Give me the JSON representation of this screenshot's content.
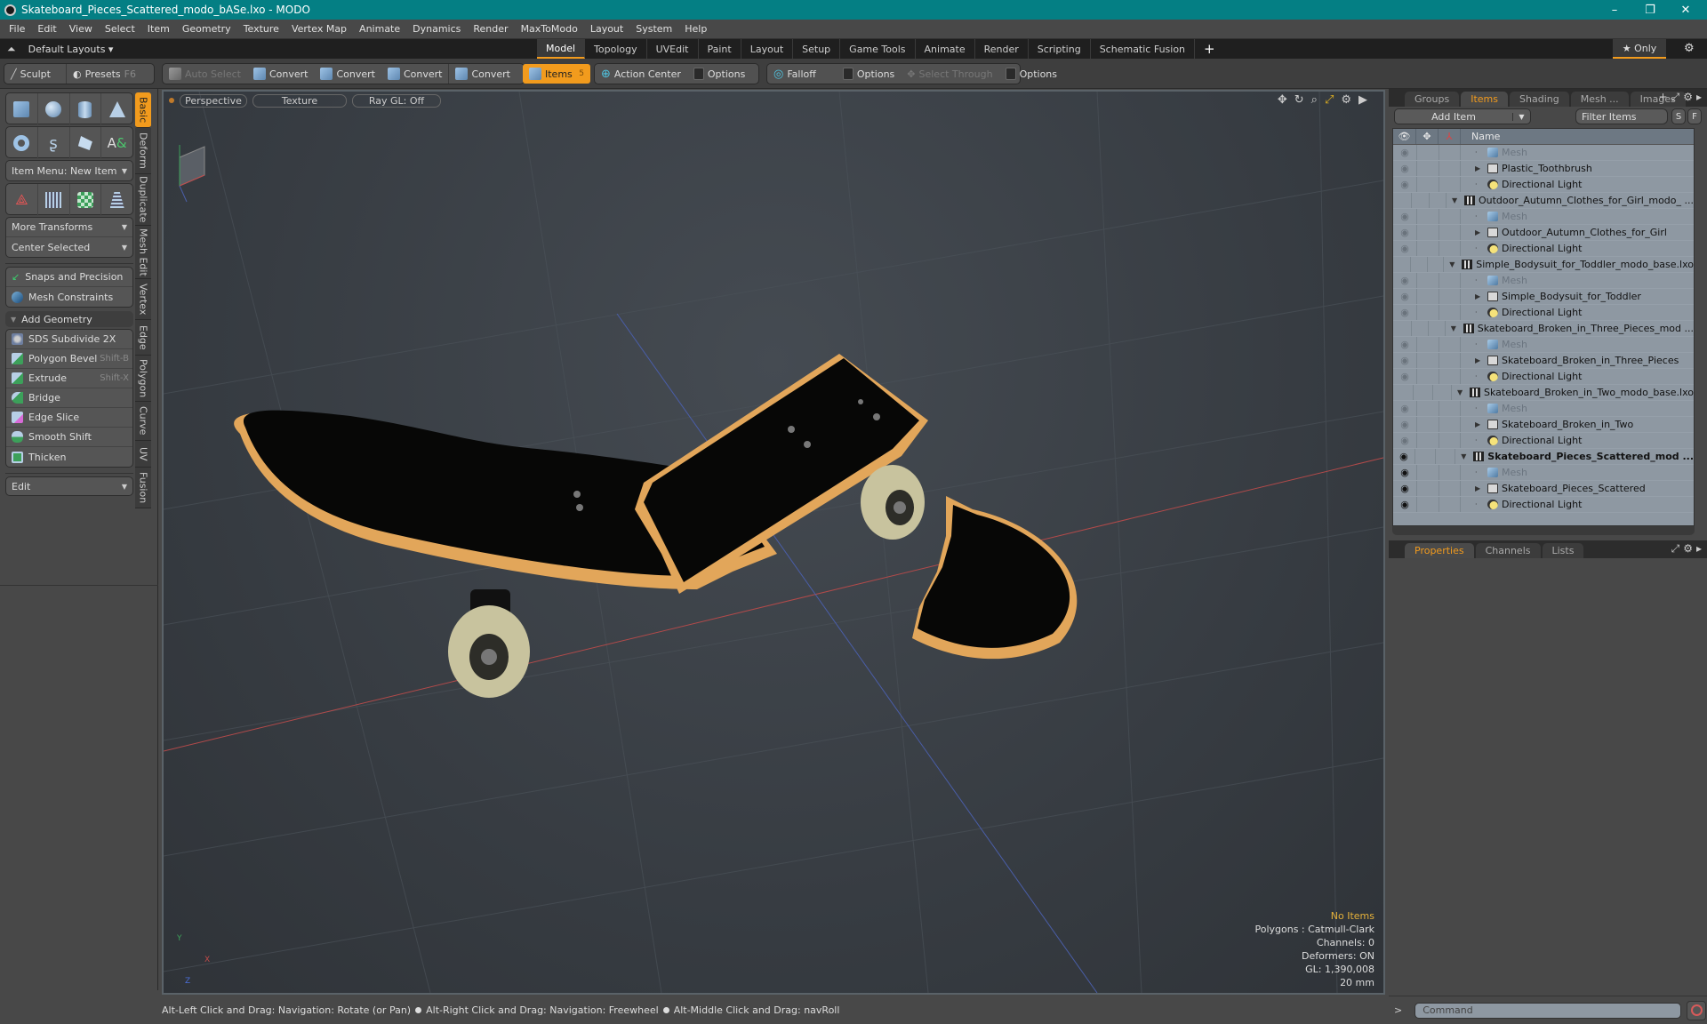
{
  "window": {
    "title": "Skateboard_Pieces_Scattered_modo_bASe.lxo - MODO",
    "controls": [
      "–",
      "❐",
      "✕"
    ]
  },
  "menu": [
    "File",
    "Edit",
    "View",
    "Select",
    "Item",
    "Geometry",
    "Texture",
    "Vertex Map",
    "Animate",
    "Dynamics",
    "Render",
    "MaxToModo",
    "Layout",
    "System",
    "Help"
  ],
  "layoutbar": {
    "layouts_label": "Default Layouts ▾",
    "tabs": [
      "Model",
      "Topology",
      "UVEdit",
      "Paint",
      "Layout",
      "Setup",
      "Game Tools",
      "Animate",
      "Render",
      "Scripting",
      "Schematic Fusion"
    ],
    "active_tab": "Model",
    "add_label": "+",
    "only_label": "★ Only"
  },
  "toolbar": {
    "sculpt": "Sculpt",
    "presets": "Presets",
    "presets_shortcut": "F6",
    "auto_select": "Auto Select",
    "convert": "Convert",
    "items": "Items",
    "items_count": "5",
    "action_center": "Action Center",
    "options": "Options",
    "falloff": "Falloff",
    "select_through": "Select Through"
  },
  "leftpanel": {
    "item_menu": "Item Menu: New Item",
    "more_transforms": "More Transforms",
    "center_selected": "Center Selected",
    "snaps": "Snaps and Precision",
    "constraints": "Mesh Constraints",
    "add_geometry": "Add Geometry",
    "tools": [
      {
        "label": "SDS Subdivide 2X",
        "shortcut": ""
      },
      {
        "label": "Polygon Bevel",
        "shortcut": "Shift-B"
      },
      {
        "label": "Extrude",
        "shortcut": "Shift-X"
      },
      {
        "label": "Bridge",
        "shortcut": ""
      },
      {
        "label": "Edge Slice",
        "shortcut": ""
      },
      {
        "label": "Smooth Shift",
        "shortcut": ""
      },
      {
        "label": "Thicken",
        "shortcut": ""
      }
    ],
    "edit": "Edit",
    "side_tabs": [
      "Basic",
      "Deform",
      "Duplicate",
      "Mesh Edit",
      "Vertex",
      "Edge",
      "Polygon",
      "Curve",
      "UV",
      "Fusion"
    ],
    "active_side_tab": "Basic"
  },
  "viewport": {
    "view": "Perspective",
    "shading": "Texture",
    "raygl": "Ray GL: Off",
    "hud": {
      "selection": "No Items",
      "polygons": "Polygons : Catmull-Clark",
      "channels": "Channels: 0",
      "deformers": "Deformers: ON",
      "gl": "GL: 1,390,008",
      "grid": "20 mm"
    },
    "axis": {
      "x": "X",
      "y": "Y",
      "z": "Z"
    }
  },
  "status": {
    "hints": [
      "Alt-Left Click and Drag: Navigation: Rotate (or Pan)",
      "Alt-Right Click and Drag: Navigation: Freewheel",
      "Alt-Middle Click and Drag: navRoll"
    ]
  },
  "rightpanel": {
    "tabs": [
      "Groups",
      "Items",
      "Shading",
      "Mesh ...",
      "Images"
    ],
    "active_tab": "Items",
    "add_item": "Add Item",
    "filter_placeholder": "Filter Items",
    "s_btn": "S",
    "f_btn": "F",
    "name_col": "Name",
    "tree": [
      {
        "type": "mesh",
        "label": "Mesh",
        "level": 1,
        "eye": "dim"
      },
      {
        "type": "group",
        "label": "Plastic_Toothbrush",
        "level": 1,
        "eye": "dim"
      },
      {
        "type": "light",
        "label": "Directional Light",
        "level": 1,
        "eye": "dim"
      },
      {
        "type": "scene",
        "label": "Outdoor_Autumn_Clothes_for_Girl_modo_ ...",
        "level": 0,
        "eye": "none"
      },
      {
        "type": "mesh",
        "label": "Mesh",
        "level": 1,
        "eye": "dim"
      },
      {
        "type": "group",
        "label": "Outdoor_Autumn_Clothes_for_Girl",
        "level": 1,
        "eye": "dim"
      },
      {
        "type": "light",
        "label": "Directional Light",
        "level": 1,
        "eye": "dim"
      },
      {
        "type": "scene",
        "label": "Simple_Bodysuit_for_Toddler_modo_base.lxo",
        "level": 0,
        "eye": "none"
      },
      {
        "type": "mesh",
        "label": "Mesh",
        "level": 1,
        "eye": "dim"
      },
      {
        "type": "group",
        "label": "Simple_Bodysuit_for_Toddler",
        "level": 1,
        "eye": "dim"
      },
      {
        "type": "light",
        "label": "Directional Light",
        "level": 1,
        "eye": "dim"
      },
      {
        "type": "scene",
        "label": "Skateboard_Broken_in_Three_Pieces_mod ...",
        "level": 0,
        "eye": "none"
      },
      {
        "type": "mesh",
        "label": "Mesh",
        "level": 1,
        "eye": "dim"
      },
      {
        "type": "group",
        "label": "Skateboard_Broken_in_Three_Pieces",
        "level": 1,
        "eye": "dim"
      },
      {
        "type": "light",
        "label": "Directional Light",
        "level": 1,
        "eye": "dim"
      },
      {
        "type": "scene",
        "label": "Skateboard_Broken_in_Two_modo_base.lxo",
        "level": 0,
        "eye": "none"
      },
      {
        "type": "mesh",
        "label": "Mesh",
        "level": 1,
        "eye": "dim"
      },
      {
        "type": "group",
        "label": "Skateboard_Broken_in_Two",
        "level": 1,
        "eye": "dim"
      },
      {
        "type": "light",
        "label": "Directional Light",
        "level": 1,
        "eye": "dim"
      },
      {
        "type": "scene",
        "label": "Skateboard_Pieces_Scattered_mod ...",
        "level": 0,
        "eye": "dark",
        "bold": true
      },
      {
        "type": "mesh",
        "label": "Mesh",
        "level": 1,
        "eye": "dark"
      },
      {
        "type": "group",
        "label": "Skateboard_Pieces_Scattered",
        "level": 1,
        "eye": "dark"
      },
      {
        "type": "light",
        "label": "Directional Light",
        "level": 1,
        "eye": "dark"
      }
    ],
    "bottom_tabs": [
      "Properties",
      "Channels",
      "Lists"
    ],
    "active_bottom_tab": "Properties",
    "command_placeholder": "Command"
  },
  "colors": {
    "accent": "#f29b1d",
    "titlebar": "#047f84",
    "tree_bg": "#8e98a2",
    "hud_warn": "#e5b13a"
  }
}
